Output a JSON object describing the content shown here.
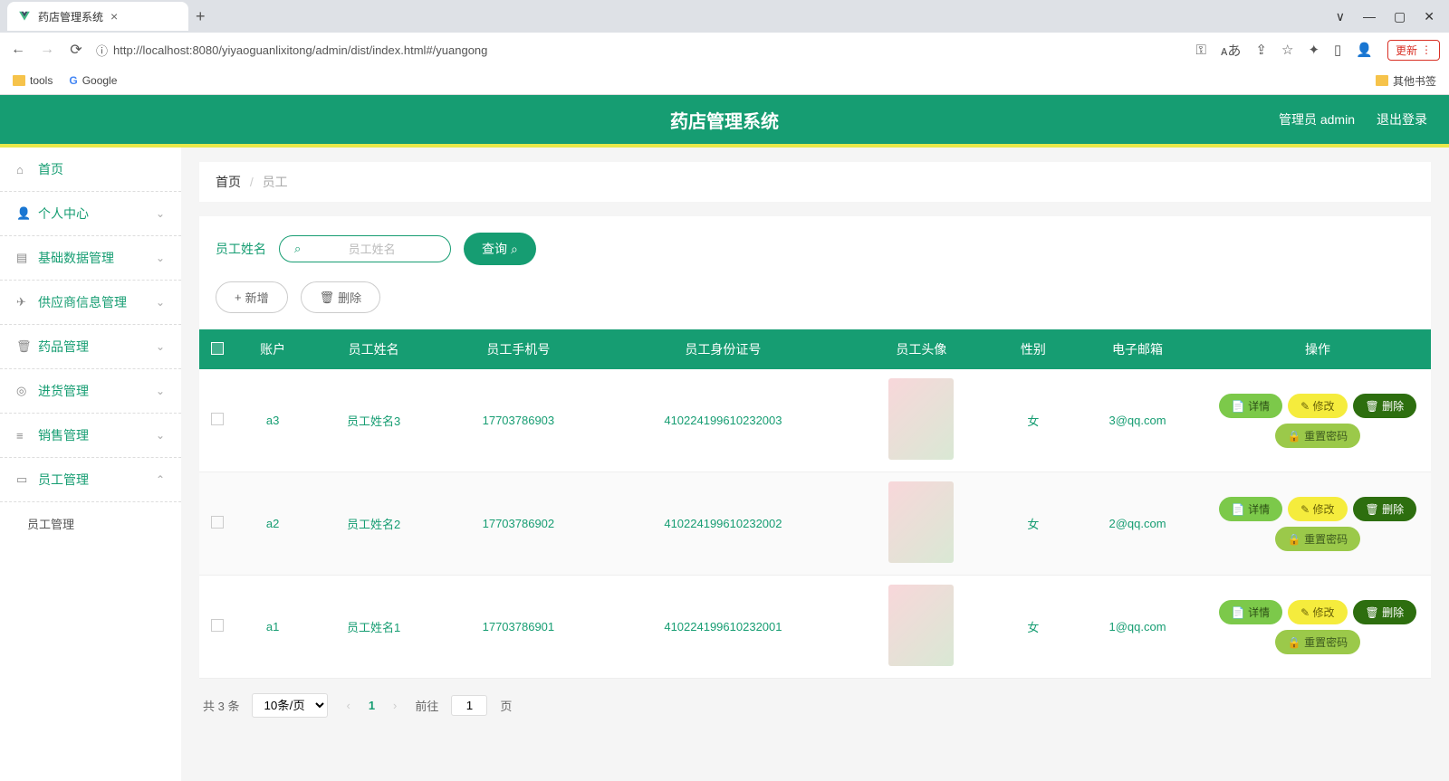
{
  "browser": {
    "tab_title": "药店管理系统",
    "url_full": "http://localhost:8080/yiyaoguanlixitong/admin/dist/index.html#/yuangong",
    "update_label": "更新",
    "bookmarks": {
      "tools": "tools",
      "google": "Google",
      "other": "其他书签"
    }
  },
  "header": {
    "title": "药店管理系统",
    "admin_label": "管理员 admin",
    "logout": "退出登录"
  },
  "sidebar": {
    "items": [
      {
        "label": "首页",
        "icon": "⌂",
        "expandable": false
      },
      {
        "label": "个人中心",
        "icon": "👤",
        "expandable": true
      },
      {
        "label": "基础数据管理",
        "icon": "▤",
        "expandable": true
      },
      {
        "label": "供应商信息管理",
        "icon": "✈",
        "expandable": true
      },
      {
        "label": "药品管理",
        "icon": "🗑",
        "expandable": true
      },
      {
        "label": "进货管理",
        "icon": "◎",
        "expandable": true
      },
      {
        "label": "销售管理",
        "icon": "≡",
        "expandable": true
      },
      {
        "label": "员工管理",
        "icon": "▭",
        "expandable": true,
        "expanded": true
      }
    ],
    "sub_label": "员工管理"
  },
  "breadcrumb": {
    "home": "首页",
    "current": "员工"
  },
  "search": {
    "label": "员工姓名",
    "placeholder": "员工姓名",
    "query_btn": "查询",
    "add_btn": "新增",
    "del_btn": "删除"
  },
  "table": {
    "headers": [
      "账户",
      "员工姓名",
      "员工手机号",
      "员工身份证号",
      "员工头像",
      "性别",
      "电子邮箱",
      "操作"
    ],
    "rows": [
      {
        "account": "a3",
        "name": "员工姓名3",
        "phone": "17703786903",
        "idcard": "410224199610232003",
        "gender": "女",
        "email": "3@qq.com"
      },
      {
        "account": "a2",
        "name": "员工姓名2",
        "phone": "17703786902",
        "idcard": "410224199610232002",
        "gender": "女",
        "email": "2@qq.com"
      },
      {
        "account": "a1",
        "name": "员工姓名1",
        "phone": "17703786901",
        "idcard": "410224199610232001",
        "gender": "女",
        "email": "1@qq.com"
      }
    ],
    "ops": {
      "detail": "详情",
      "edit": "修改",
      "del": "删除",
      "reset": "重置密码"
    }
  },
  "pagination": {
    "total_text": "共 3 条",
    "per_page": "10条/页",
    "current": "1",
    "goto_prefix": "前往",
    "goto_suffix": "页",
    "goto_value": "1"
  }
}
